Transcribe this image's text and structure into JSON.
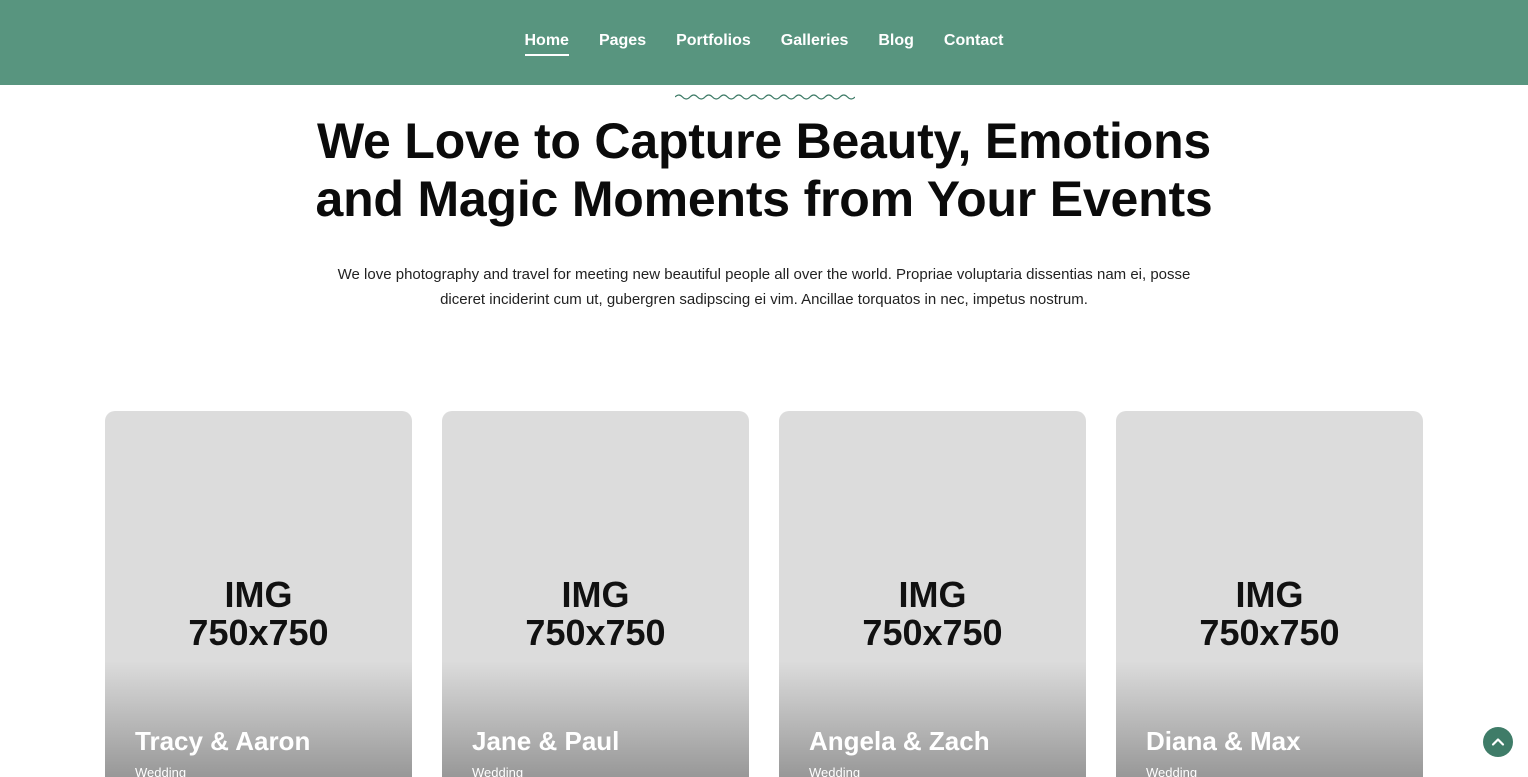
{
  "colors": {
    "header_bg": "#58957f",
    "accent": "#3f7c68",
    "card_bg": "#dcdcdc"
  },
  "nav": {
    "items": [
      {
        "label": "Home",
        "active": true
      },
      {
        "label": "Pages",
        "active": false
      },
      {
        "label": "Portfolios",
        "active": false
      },
      {
        "label": "Galleries",
        "active": false
      },
      {
        "label": "Blog",
        "active": false
      },
      {
        "label": "Contact",
        "active": false
      }
    ]
  },
  "hero": {
    "decor_icon": "wave-divider-icon",
    "headline_line1": "We Love to Capture Beauty, Emotions",
    "headline_line2": "and Magic Moments from Your Events",
    "intro_line1": "We love photography and travel for meeting new beautiful people all over the world. Propriae voluptaria dissentias nam ei, posse",
    "intro_line2": "diceret inciderint cum ut, gubergren sadipscing ei vim. Ancillae torquatos in nec, impetus nostrum."
  },
  "portfolio": {
    "cards": [
      {
        "placeholder_line1": "IMG",
        "placeholder_line2": "750x750",
        "title": "Tracy & Aaron",
        "category": "Wedding"
      },
      {
        "placeholder_line1": "IMG",
        "placeholder_line2": "750x750",
        "title": "Jane & Paul",
        "category": "Wedding"
      },
      {
        "placeholder_line1": "IMG",
        "placeholder_line2": "750x750",
        "title": "Angela & Zach",
        "category": "Wedding"
      },
      {
        "placeholder_line1": "IMG",
        "placeholder_line2": "750x750",
        "title": "Diana & Max",
        "category": "Wedding"
      }
    ]
  },
  "scroll_top": {
    "icon": "chevron-up-icon"
  }
}
